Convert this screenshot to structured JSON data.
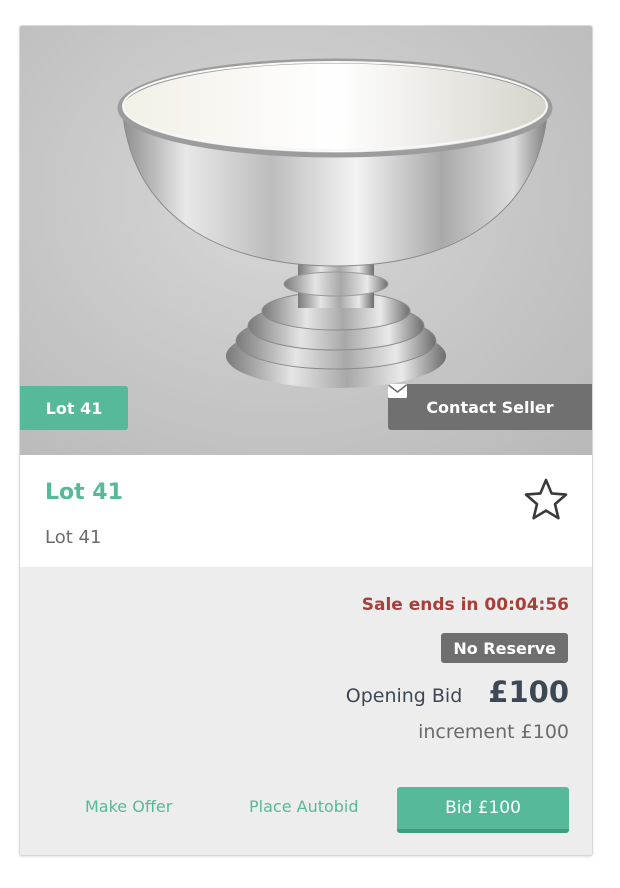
{
  "lot": {
    "badge": "Lot 41",
    "title": "Lot 41",
    "subtitle": "Lot 41",
    "image_alt": "Silver footed bowl"
  },
  "actions": {
    "contact_seller": "Contact Seller",
    "make_offer": "Make Offer",
    "place_autobid": "Place Autobid",
    "bid": "Bid £100"
  },
  "status": {
    "sale_ends": "Sale ends in 00:04:56",
    "reserve": "No Reserve"
  },
  "pricing": {
    "opening_label": "Opening Bid",
    "opening_value": "£100",
    "increment": "increment £100"
  },
  "icons": {
    "contact": "envelope-icon",
    "watch": "star-icon"
  },
  "colors": {
    "accent": "#56b99a",
    "alert": "#a8403a",
    "badge_grey": "#6f6f6f",
    "text_dark": "#3d4855"
  }
}
